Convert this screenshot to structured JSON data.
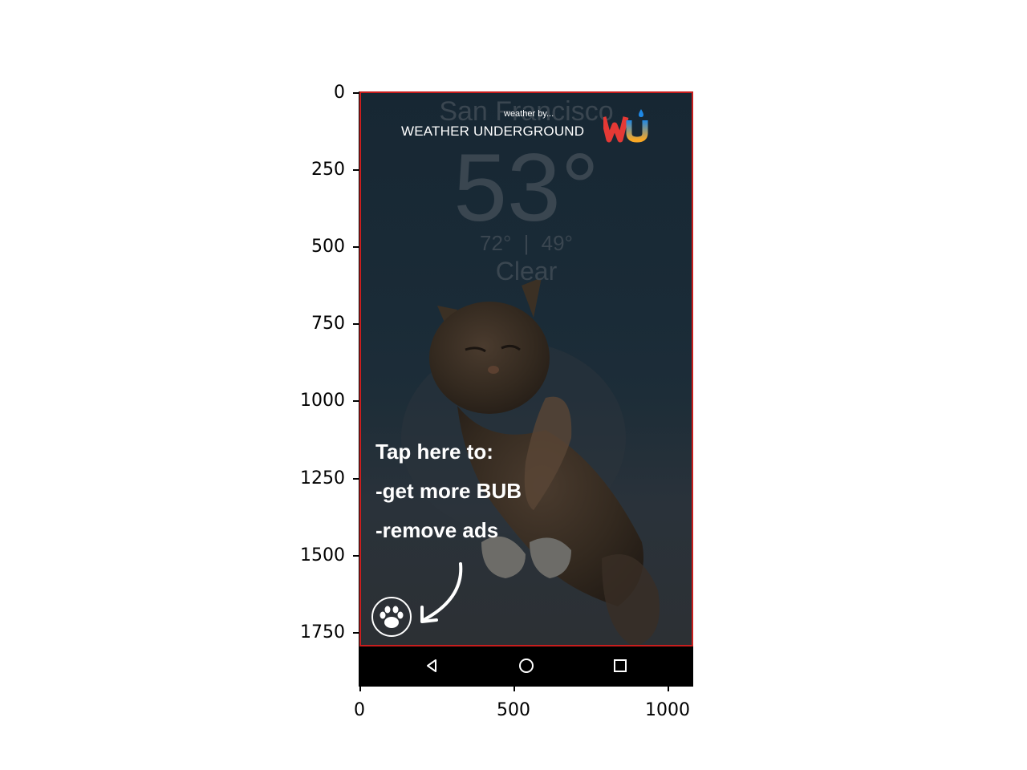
{
  "axes": {
    "y_ticks": [
      "0",
      "250",
      "500",
      "750",
      "1000",
      "1250",
      "1500",
      "1750"
    ],
    "x_ticks": [
      "0",
      "500",
      "1000"
    ]
  },
  "weather": {
    "city": "San Francisco",
    "temperature": "53°",
    "high": "72°",
    "separator": "|",
    "low": "49°",
    "condition": "Clear"
  },
  "branding": {
    "tagline": "weather by...",
    "name": "WEATHER UNDERGROUND",
    "colors": {
      "w": "#e53935",
      "u_start": "#f9a825",
      "u_end": "#1e88e5"
    }
  },
  "promo": {
    "line1": "Tap here to:",
    "line2": "-get more BUB",
    "line3": "-remove ads"
  },
  "nav": {
    "back_icon": "back-triangle-icon",
    "home_icon": "home-circle-icon",
    "recents_icon": "recents-square-icon"
  },
  "colors": {
    "border_highlight": "#c81e1e",
    "nav_bar": "#000000"
  }
}
